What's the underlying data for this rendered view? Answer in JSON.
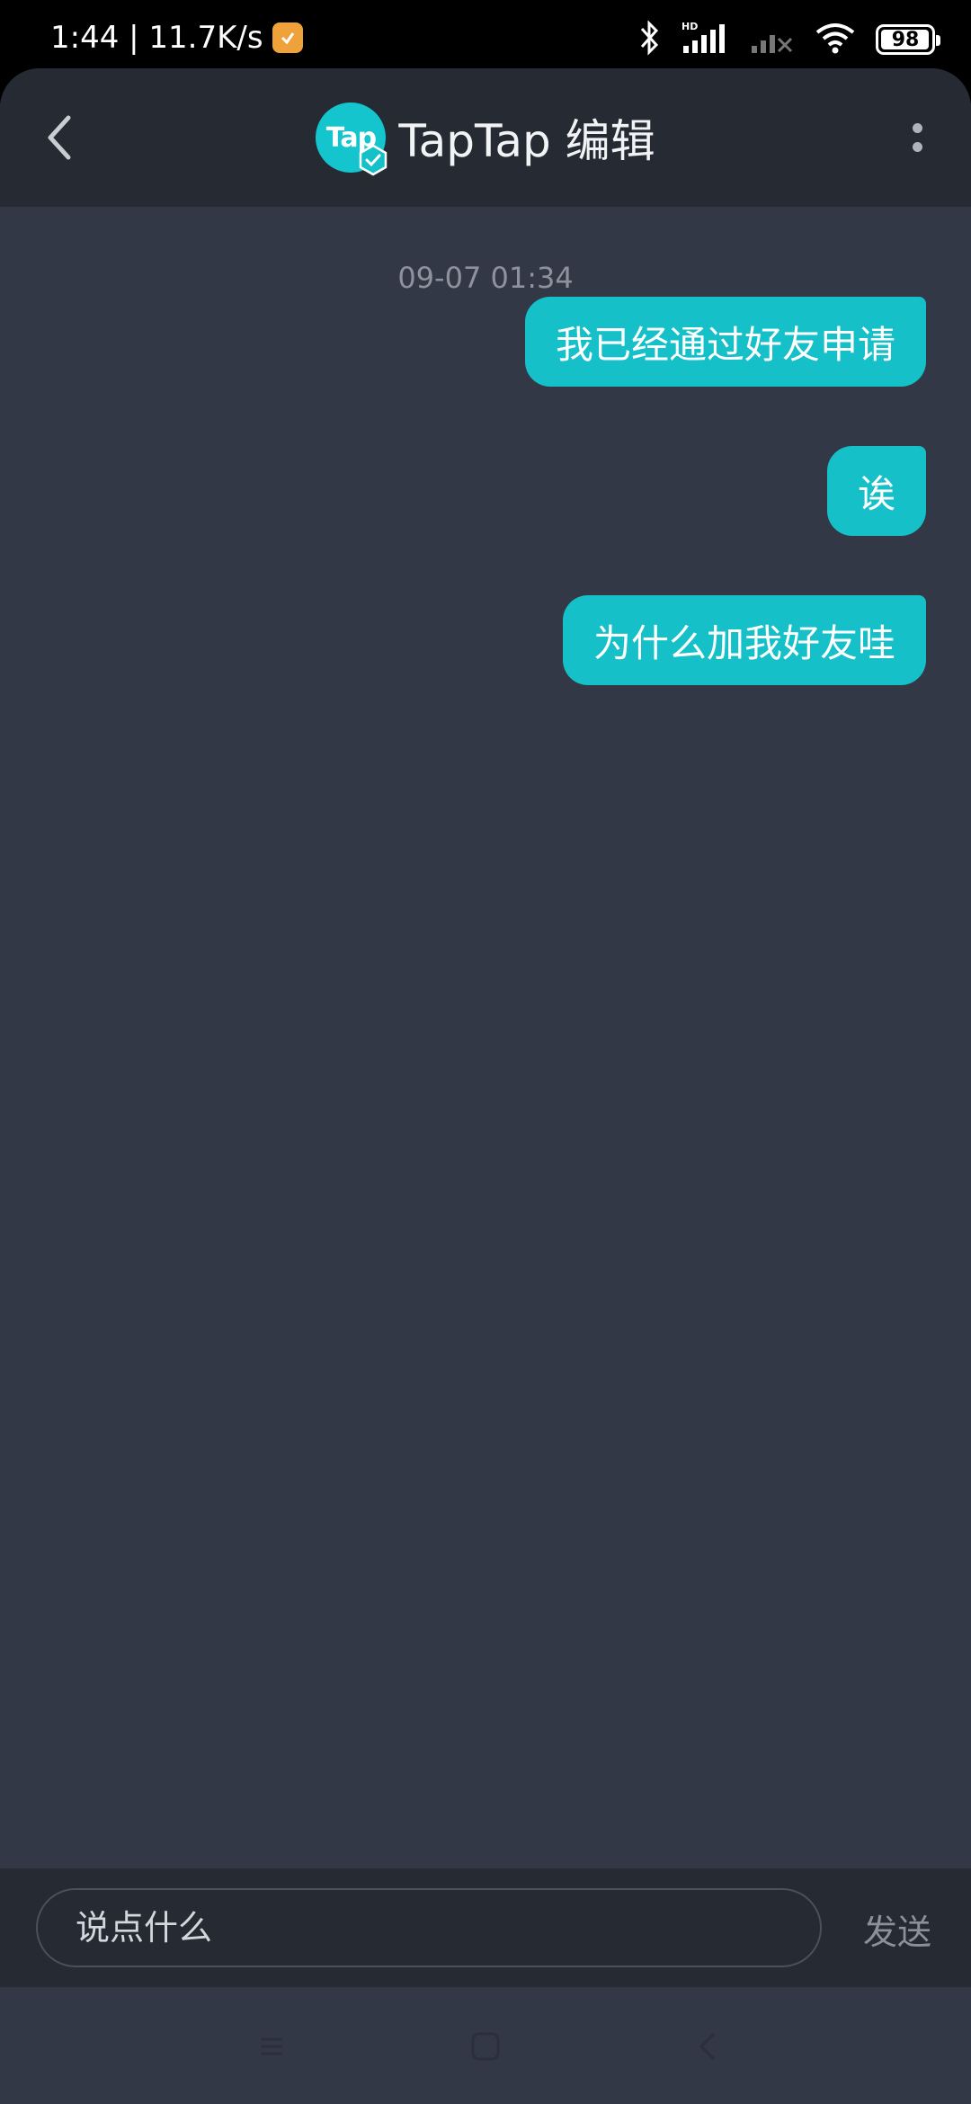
{
  "status_bar": {
    "time_speed": "1:44 | 11.7K/s",
    "battery_level": "98",
    "battery_fraction": 0.98
  },
  "header": {
    "avatar_text": "Tap",
    "title": "TapTap 编辑"
  },
  "chat": {
    "timestamp": "09-07 01:34",
    "messages": [
      {
        "text": "我已经通过好友申请",
        "sender": "me"
      },
      {
        "text": "诶",
        "sender": "me"
      },
      {
        "text": "为什么加我好友哇",
        "sender": "me"
      }
    ]
  },
  "input": {
    "placeholder": "说点什么",
    "send_label": "发送"
  },
  "colors": {
    "accent": "#16c0c9",
    "background": "#323846",
    "header": "#252a33"
  },
  "icons": {
    "back": "back-chevron-icon",
    "more": "more-vertical-icon",
    "verified": "verified-badge-icon",
    "bluetooth": "bluetooth-icon",
    "signal": "signal-icon",
    "wifi": "wifi-icon",
    "battery": "battery-icon"
  }
}
